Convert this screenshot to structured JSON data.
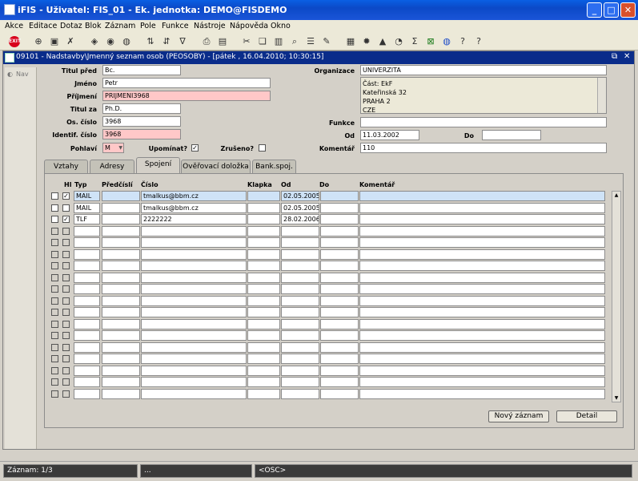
{
  "app": {
    "title": "iFIS - Uživatel: FIS_01 - Ek. jednotka: DEMO@FISDEMO"
  },
  "menu": [
    "Akce",
    "Editace",
    "Dotaz",
    "Blok",
    "Záznam",
    "Pole",
    "Funkce",
    "Nástroje",
    "Nápověda",
    "Okno"
  ],
  "toolbar": {
    "exit_label": "EXIT"
  },
  "form": {
    "title": "09101 - Nadstavby\\Jmenný seznam osob (PEOSOBY) - [pátek , 16.04.2010; 10:30:15]",
    "nav_label": "Nav",
    "labels": {
      "titul_pred": "Titul před",
      "jmeno": "Jméno",
      "prijmeni": "Příjmení",
      "titul_za": "Titul za",
      "os_cislo": "Os. číslo",
      "identif": "Identif. číslo",
      "pohlavi": "Pohlaví",
      "upominat": "Upomínat?",
      "zruseno": "Zrušeno?",
      "organizace": "Organizace",
      "funkce": "Funkce",
      "od": "Od",
      "do": "Do",
      "komentar": "Komentář"
    },
    "values": {
      "titul_pred": "Bc.",
      "jmeno": "Petr",
      "prijmeni": "PRIJMENI3968",
      "titul_za": "Ph.D.",
      "os_cislo": "3968",
      "identif": "3968",
      "pohlavi": "M",
      "upominat": true,
      "zruseno": false,
      "organizace": "UNIVERZITA",
      "org_address": [
        "Část: EkF",
        "Kateřinská 32",
        "PRAHA 2",
        "CZE"
      ],
      "funkce": "",
      "od": "11.03.2002",
      "do": "",
      "komentar": "110"
    }
  },
  "tabs": [
    {
      "label": "Vztahy",
      "active": false
    },
    {
      "label": "Adresy",
      "active": false
    },
    {
      "label": "Spojení",
      "active": true
    },
    {
      "label": "Ověřovací doložka",
      "active": false
    },
    {
      "label": "Bank.spoj.",
      "active": false
    }
  ],
  "grid": {
    "headers": {
      "hl": "Hl",
      "typ": "Typ",
      "predcisli": "Předčíslí",
      "cislo": "Číslo",
      "klapka": "Klapka",
      "od": "Od",
      "do": "Do",
      "komentar": "Komentář"
    },
    "rows": [
      {
        "c1": false,
        "c2": true,
        "typ": "MAIL",
        "predcisli": "",
        "cislo": "tmalkus@bbm.cz",
        "klapka": "",
        "od": "02.05.2005",
        "do": "",
        "komentar": ""
      },
      {
        "c1": false,
        "c2": false,
        "typ": "MAIL",
        "predcisli": "",
        "cislo": "tmalkus@bbm.cz",
        "klapka": "",
        "od": "02.05.2005",
        "do": "",
        "komentar": ""
      },
      {
        "c1": false,
        "c2": true,
        "typ": "TLF",
        "predcisli": "",
        "cislo": "2222222",
        "klapka": "",
        "od": "28.02.2006",
        "do": "",
        "komentar": ""
      }
    ],
    "total_rows": 18
  },
  "buttons": {
    "novy": "Nový záznam",
    "detail": "Detail"
  },
  "status": {
    "record": "Záznam: 1/3",
    "dots": "...",
    "osc": "<OSC>"
  }
}
